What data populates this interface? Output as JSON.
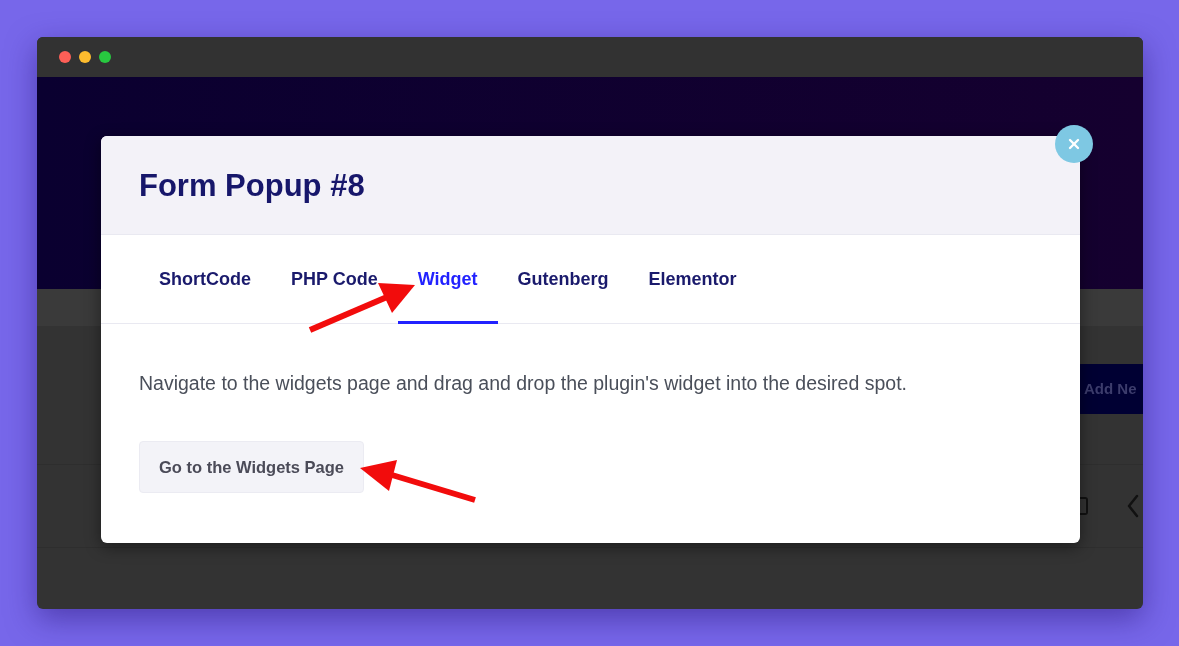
{
  "background_page": {
    "button": "Add Ne"
  },
  "modal": {
    "title": "Form Popup #8",
    "tabs": [
      {
        "label": "ShortCode",
        "selected": false
      },
      {
        "label": "PHP Code",
        "selected": false
      },
      {
        "label": "Widget",
        "selected": true
      },
      {
        "label": "Gutenberg",
        "selected": false
      },
      {
        "label": "Elementor",
        "selected": false
      }
    ],
    "description": "Navigate to the widgets page and drag and drop the plugin's widget into the desired spot.",
    "button": "Go to the Widgets Page"
  }
}
